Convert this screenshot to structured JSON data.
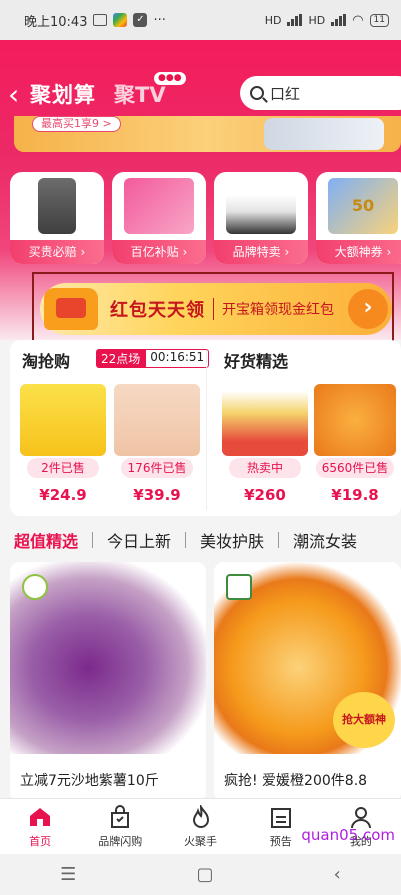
{
  "status_bar": {
    "time": "晚上10:43",
    "battery": "11",
    "net1": "HD",
    "net2": "HD"
  },
  "header": {
    "title": "聚划算",
    "tab_tv": "聚TV",
    "tv_badge": "●●●",
    "search_placeholder": "口红",
    "strip_text": "最高买1享9 >"
  },
  "categories": [
    {
      "label": "买贵必赔",
      "icon": "trousers-icon"
    },
    {
      "label": "百亿补贴",
      "icon": "gift-box-icon"
    },
    {
      "label": "品牌特卖",
      "icon": "sneaker-icon"
    },
    {
      "label": "大额神券",
      "icon": "coupon-icon",
      "coupon_value": "50"
    }
  ],
  "red_envelope": {
    "title": "红包天天领",
    "subtitle": "开宝箱领现金红包"
  },
  "flash_sale": {
    "title": "淘抢购",
    "session": "22点场",
    "countdown": "00:16:51",
    "items": [
      {
        "sold": "2件已售",
        "price": "¥24.9"
      },
      {
        "sold": "176件已售",
        "price": "¥39.9"
      }
    ]
  },
  "good_picks": {
    "title": "好货精选",
    "items": [
      {
        "sold": "热卖中",
        "price": "¥260"
      },
      {
        "sold": "6560件已售",
        "price": "¥19.8"
      }
    ]
  },
  "tabs": [
    "超值精选",
    "今日上新",
    "美妆护肤",
    "潮流女装"
  ],
  "products": [
    {
      "name": "立减7元沙地紫薯10斤"
    },
    {
      "name": "疯抢! 爱媛橙200件8.8",
      "tag": "抢大额神"
    }
  ],
  "bottom_nav": [
    {
      "label": "首页",
      "icon": "home-icon",
      "active": true
    },
    {
      "label": "品牌闪购",
      "icon": "shopping-bag-icon",
      "active": false
    },
    {
      "label": "火聚手",
      "icon": "flame-icon",
      "active": false
    },
    {
      "label": "预告",
      "icon": "calendar-icon",
      "active": false
    },
    {
      "label": "我的",
      "icon": "person-icon",
      "active": false
    }
  ],
  "watermark": "quan05.com",
  "colors": {
    "brand": "#e8124f",
    "accent": "#f41c5a"
  }
}
